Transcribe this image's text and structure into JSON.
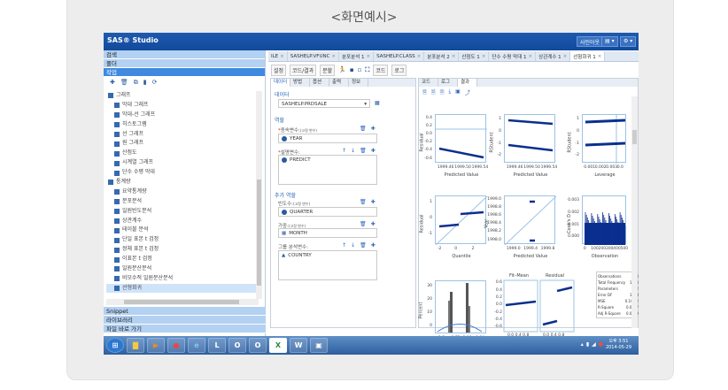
{
  "page": {
    "title": "<화면예시>"
  },
  "app": {
    "logo": "SAS® Studio",
    "signout": "사인아웃",
    "menu_btn": "▤ ▾",
    "settings_btn": "⚙ ▾"
  },
  "left": {
    "accordions_top": [
      {
        "label": "검색"
      },
      {
        "label": "폴더"
      },
      {
        "label": "작업"
      }
    ],
    "tree": [
      {
        "label": "그래프",
        "group": true
      },
      {
        "label": "막대 그래프"
      },
      {
        "label": "막대-선 그래프"
      },
      {
        "label": "히스토그램"
      },
      {
        "label": "선 그래프"
      },
      {
        "label": "원 그래프"
      },
      {
        "label": "산점도"
      },
      {
        "label": "시계열 그래프"
      },
      {
        "label": "단수 수평 막대"
      },
      {
        "label": "통계량",
        "group": true
      },
      {
        "label": "요약통계량"
      },
      {
        "label": "분포분석"
      },
      {
        "label": "일원빈도분석"
      },
      {
        "label": "상관계수"
      },
      {
        "label": "테이블 분석"
      },
      {
        "label": "단일 표본 t 검정"
      },
      {
        "label": "쌍체 표본 t 검정"
      },
      {
        "label": "이표본 t 검정"
      },
      {
        "label": "일원분산분석"
      },
      {
        "label": "비모수적 일원분산분석"
      },
      {
        "label": "선형회귀",
        "selected": true
      }
    ],
    "accordions_bottom": [
      {
        "label": "Snippet"
      },
      {
        "label": "라이브러리"
      },
      {
        "label": "파일 바로 가기"
      }
    ]
  },
  "tabs": [
    {
      "label": "ILE"
    },
    {
      "label": "SASHELP.VFUNC"
    },
    {
      "label": "분포분석 1"
    },
    {
      "label": "SASHELP.CLASS"
    },
    {
      "label": "분포분석 2"
    },
    {
      "label": "산점도 1"
    },
    {
      "label": "단수 수평 막대 1"
    },
    {
      "label": "상관계수 1"
    },
    {
      "label": "선형회귀 1",
      "active": true
    }
  ],
  "toolbar": {
    "settings": "설정",
    "code_result": "코드/결과",
    "split": "분할",
    "code": "코드",
    "log": "로그"
  },
  "task": {
    "subtabs": [
      "데이터",
      "방법",
      "옵션",
      "출력",
      "정보"
    ],
    "data_section": "데이터",
    "dataset": "SASHELP.PRDSALE",
    "roles_section": "역할",
    "dep_label": "종속변수:",
    "dep_hint": "(고정 변수)",
    "dep_value": "YEAR",
    "expl_label": "설명변수:",
    "expl_value": "PREDICT",
    "extra_section": "추가 역할",
    "freq_label": "빈도수:",
    "freq_hint": "(고정 변수)",
    "freq_value": "QUARTER",
    "weight_label": "가중:",
    "weight_hint": "(고정 변수)",
    "weight_value": "MONTH",
    "group_label": "그룹 분석변수:",
    "group_value": "COUNTRY"
  },
  "results": {
    "tabs": [
      "코드",
      "로그",
      "결과"
    ],
    "plots": [
      {
        "ylabel": "Residual",
        "xlabel": "Predicted Value",
        "yticks": [
          "0.4",
          "0.2",
          "0.0",
          "-0.2",
          "-0.4",
          "-0.6"
        ],
        "xticks": [
          "1999.46",
          "1999.50",
          "1999.54"
        ]
      },
      {
        "ylabel": "RStudent",
        "xlabel": "Predicted Value",
        "yticks": [
          "1",
          "0",
          "-1",
          "-2"
        ],
        "xticks": [
          "1999.46",
          "1999.50",
          "1999.54"
        ]
      },
      {
        "ylabel": "RStudent",
        "xlabel": "Leverage",
        "yticks": [
          "1",
          "0",
          "-1",
          "-2"
        ],
        "xticks": [
          "0.001",
          "0.002",
          "0.003",
          "0.0"
        ]
      },
      {
        "ylabel": "Residual",
        "xlabel": "Quantile",
        "yticks": [
          "1",
          "0",
          "-1"
        ],
        "xticks": [
          "-2",
          "0",
          "2"
        ]
      },
      {
        "ylabel": "Year",
        "xlabel": "Predicted Value",
        "yticks": [
          "1999.0",
          "1998.8",
          "1998.6",
          "1998.4",
          "1998.2",
          "1998.0"
        ],
        "xticks": [
          "1999.0",
          "1999.4",
          "1999.8"
        ]
      },
      {
        "ylabel": "Cook's D",
        "xlabel": "Observation",
        "yticks": [
          "0.003",
          "0.002",
          "0.001",
          "0.000"
        ],
        "xticks": [
          "0",
          "100",
          "200",
          "300",
          "400",
          "500"
        ]
      },
      {
        "ylabel": "Percent",
        "xlabel": "Residual",
        "yticks": [
          "30",
          "20",
          "10",
          "0"
        ],
        "xticks": [
          "-1.5",
          "-0.72",
          "0.06",
          "0.84"
        ]
      },
      {
        "ylabel": "",
        "xlabel": "Proportion Less",
        "yticks": [
          "0.6",
          "0.4",
          "0.2",
          "0.0",
          "-0.2",
          "-0.4",
          "-0.6"
        ],
        "xticks": [
          "0.0 0.4 0.8",
          "0.0 0.4 0.8"
        ],
        "panels": [
          "Fit–Mean",
          "Residual"
        ]
      }
    ],
    "stats": [
      {
        "label": "Observations",
        "value": "480"
      },
      {
        "label": "Total Frequency",
        "value": "1200"
      },
      {
        "label": "Parameters",
        "value": "2"
      },
      {
        "label": "Error DF",
        "value": "1198"
      },
      {
        "label": "MSE",
        "value": "0.106.2"
      },
      {
        "label": "R-Square",
        "value": "0.0007"
      },
      {
        "label": "Adj R-Square",
        "value": "0.0019"
      }
    ]
  },
  "taskbar": {
    "time": "오후 3:51",
    "date": "2014-05-29"
  }
}
